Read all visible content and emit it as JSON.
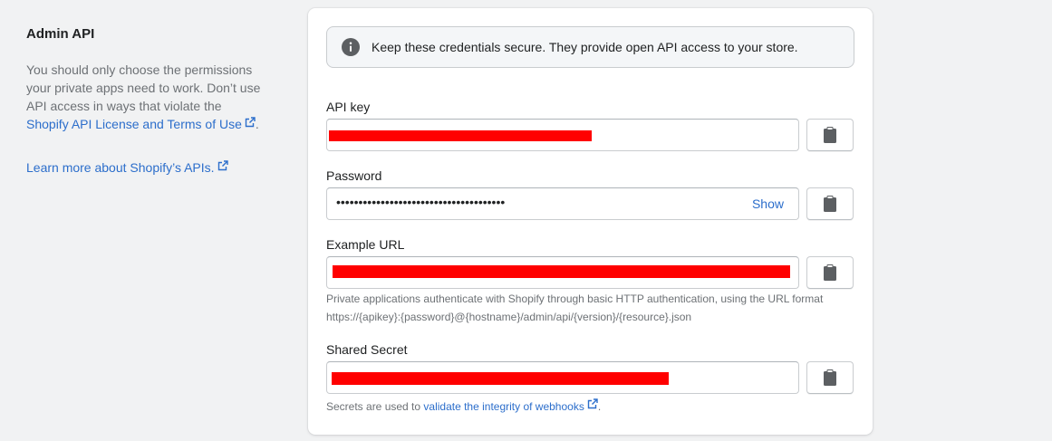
{
  "left": {
    "title": "Admin API",
    "description_prefix": "You should only choose the permissions your private apps need to work. Don’t use API access in ways that violate the ",
    "license_link": "Shopify API License and Terms of Use",
    "description_suffix": ".",
    "learn_more": "Learn more about Shopify’s APIs."
  },
  "banner": {
    "text": "Keep these credentials secure. They provide open API access to your store."
  },
  "fields": {
    "api_key": {
      "label": "API key"
    },
    "password": {
      "label": "Password",
      "masked_value": "••••••••••••••••••••••••••••••••••••••",
      "show_label": "Show"
    },
    "example_url": {
      "label": "Example URL",
      "help_line1": "Private applications authenticate with Shopify through basic HTTP authentication, using the URL format",
      "help_line2": "https://{apikey}:{password}@{hostname}/admin/api/{version}/{resource}.json"
    },
    "shared_secret": {
      "label": "Shared Secret",
      "help_prefix": "Secrets are used to ",
      "help_link": "validate the integrity of webhooks",
      "help_suffix": "."
    }
  },
  "icons": {
    "info": "info-icon",
    "clipboard": "clipboard-icon",
    "external_link": "external-link-icon"
  },
  "colors": {
    "link": "#2c6ecb",
    "redaction": "#ff0000",
    "card_bg": "#ffffff",
    "page_bg": "#f1f2f3"
  }
}
